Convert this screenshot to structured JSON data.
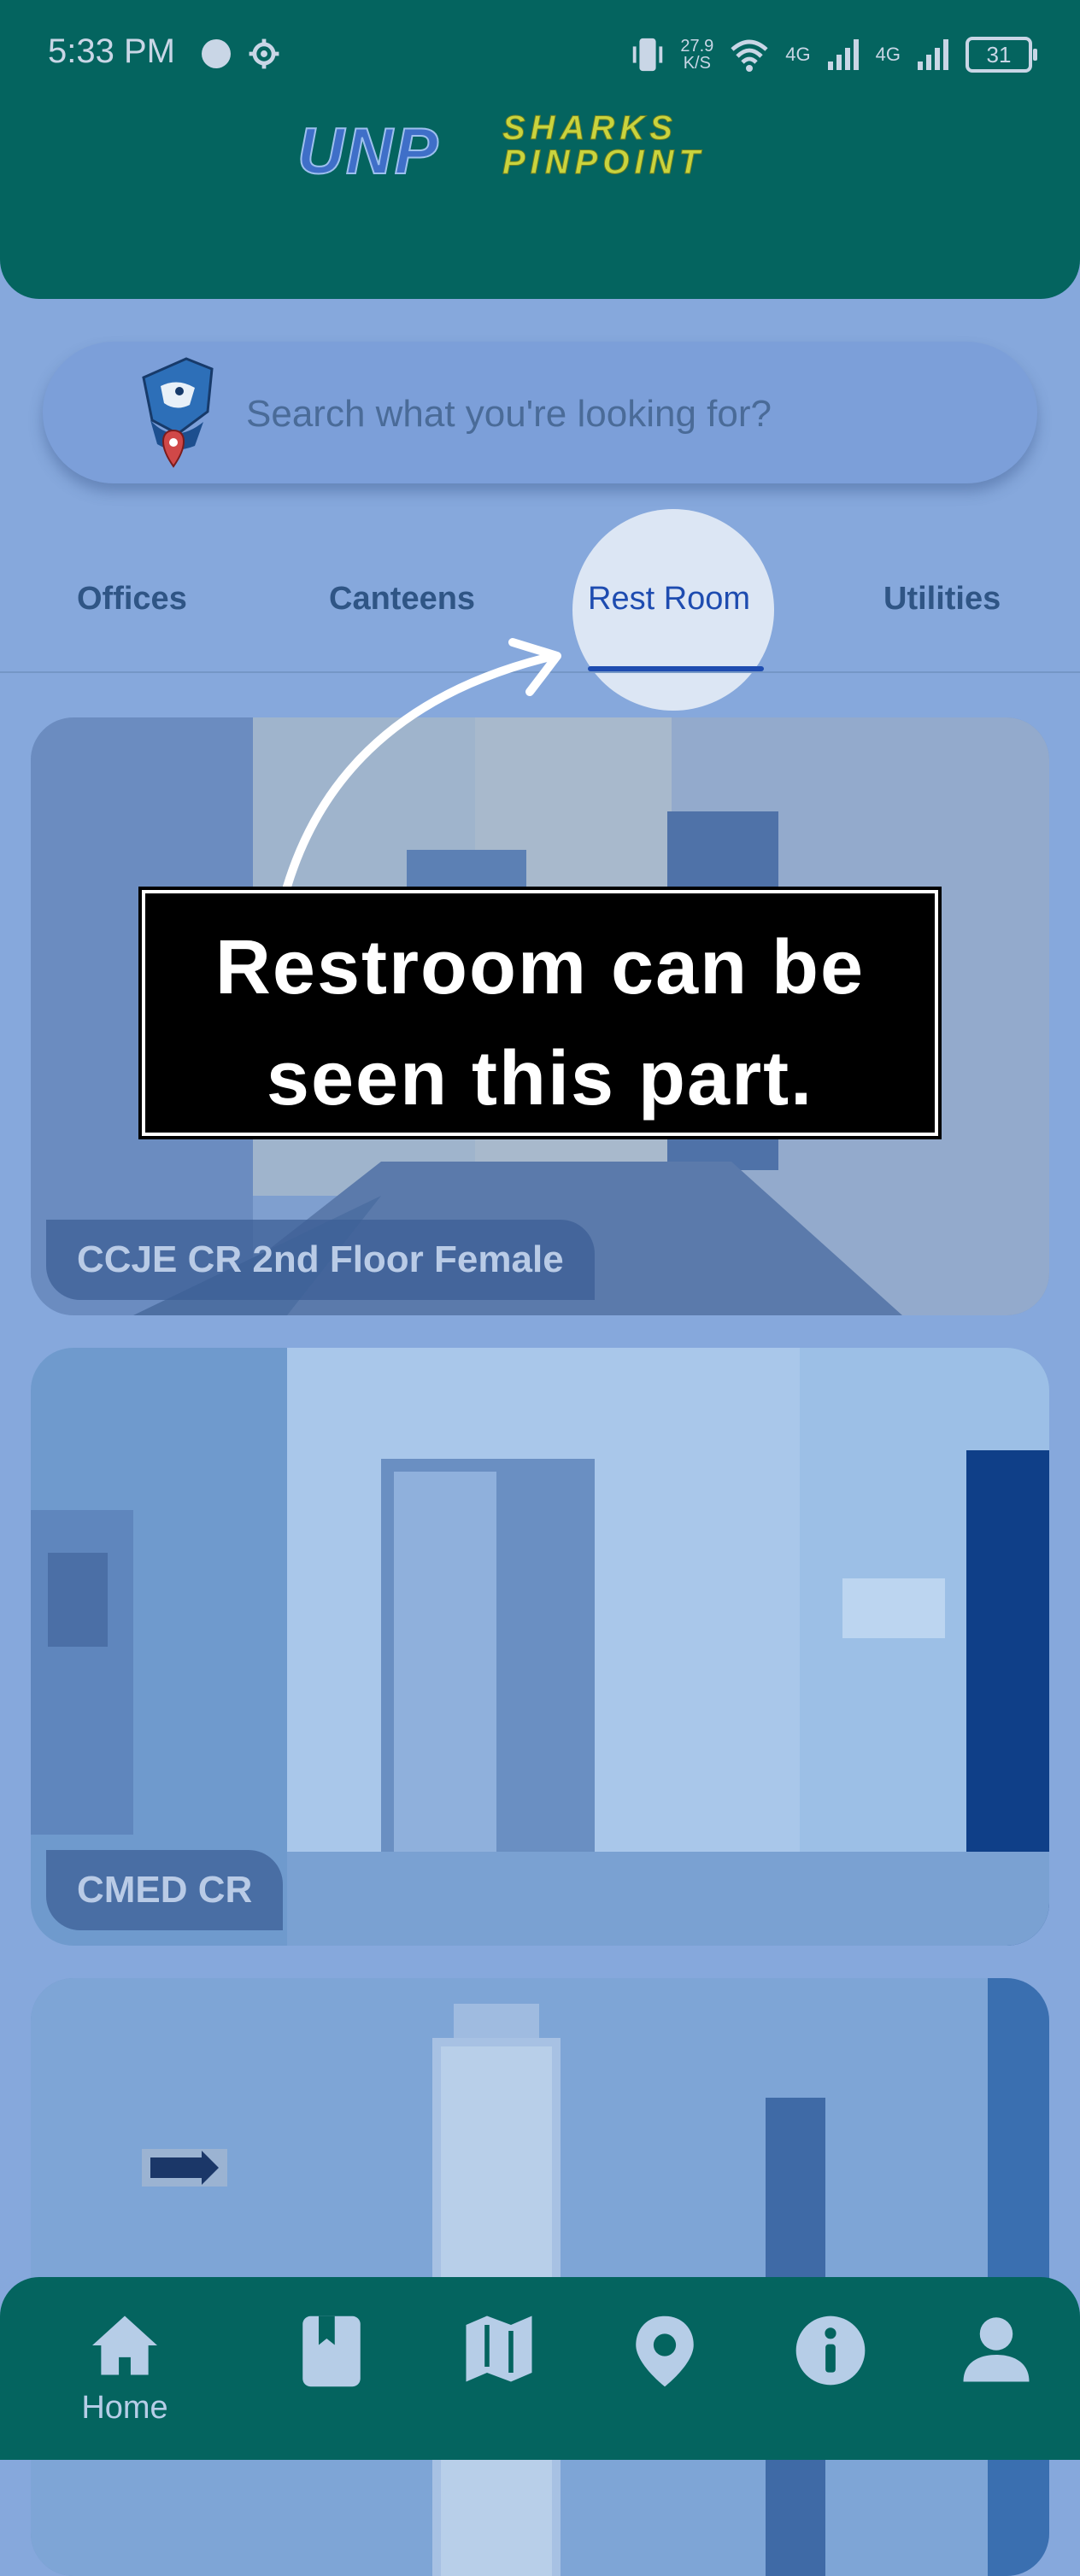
{
  "status_bar": {
    "time": "5:33 PM",
    "speed_value": "27.9",
    "speed_unit": "K/S",
    "network_1": "4G",
    "network_2": "4G",
    "battery": "31"
  },
  "header": {
    "logo_primary": "UNP",
    "logo_line1": "SHARKS",
    "logo_line2": "PINPOINT"
  },
  "search": {
    "placeholder": "Search what you're looking for?"
  },
  "tabs": [
    {
      "label": "Offices"
    },
    {
      "label": "Canteens"
    },
    {
      "label": "Rest Room",
      "active": true
    },
    {
      "label": "Utilities"
    }
  ],
  "cards": [
    {
      "label": "CCJE CR 2nd Floor Female"
    },
    {
      "label": "CMED CR"
    },
    {
      "label": ""
    }
  ],
  "callout": {
    "line1": "Restroom can be",
    "line2": "seen this part."
  },
  "bottom_nav": [
    {
      "icon": "home-icon",
      "label": "Home"
    },
    {
      "icon": "book-icon",
      "label": ""
    },
    {
      "icon": "map-icon",
      "label": ""
    },
    {
      "icon": "location-pin-icon",
      "label": ""
    },
    {
      "icon": "info-icon",
      "label": ""
    },
    {
      "icon": "profile-icon",
      "label": ""
    }
  ],
  "colors": {
    "header_bg": "#04645f",
    "page_overlay": "#86a8dc",
    "tab_text": "#2f5585",
    "tab_indicator": "#1e4cb0"
  }
}
